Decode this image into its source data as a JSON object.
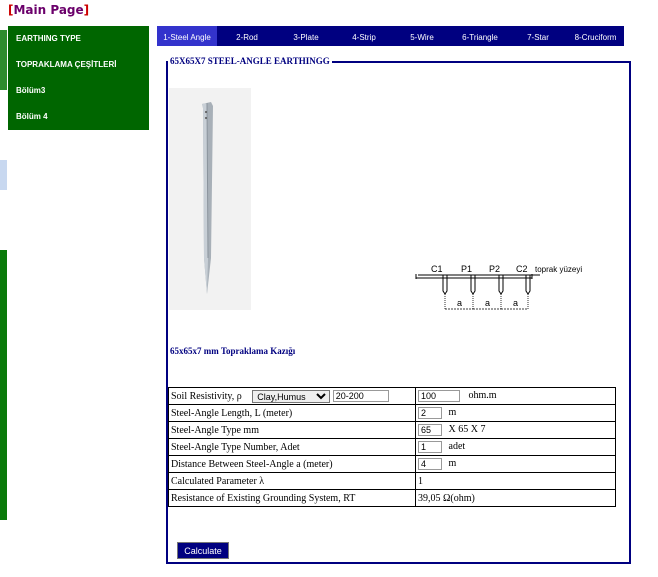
{
  "main_link": {
    "open": "[",
    "label": "Main Page",
    "close": "]"
  },
  "sidebar": {
    "items": [
      {
        "label": "EARTHING TYPE"
      },
      {
        "label": "TOPRAKLAMA ÇEŞİTLERİ"
      },
      {
        "label": "Bölüm3"
      },
      {
        "label": "Bölüm  4"
      }
    ]
  },
  "tabs": [
    {
      "label": "1-Steel Angle",
      "active": true
    },
    {
      "label": "2-Rod"
    },
    {
      "label": "3-Plate"
    },
    {
      "label": "4-Strip"
    },
    {
      "label": "5-Wire"
    },
    {
      "label": "6-Triangle"
    },
    {
      "label": "7-Star"
    },
    {
      "label": "8-Cruciform"
    }
  ],
  "panel": {
    "title": "65X65X7  STEEL-ANGLE EARTHINGG",
    "caption": "65x65x7 mm Topraklama Kazığı",
    "diagram": {
      "labels": [
        "C1",
        "P1",
        "P2",
        "C2"
      ],
      "surface_label": "toprak yüzeyi",
      "spacing_label": "a"
    }
  },
  "form": {
    "rows": [
      {
        "label": "Soil Resistivity, ρ",
        "select": "Clay,Humus",
        "range": "20-200",
        "value": "100",
        "unit": "ohm.m"
      },
      {
        "label": "Steel-Angle Length, L (meter)",
        "value": "2",
        "unit": "m"
      },
      {
        "label": "Steel-Angle Type  mm",
        "value": "65",
        "unit": "X 65  X  7"
      },
      {
        "label": "Steel-Angle Type Number, Adet",
        "value": "1",
        "unit": "adet"
      },
      {
        "label": "Distance Between Steel-Angle a (meter)",
        "value": "4",
        "unit": "m"
      },
      {
        "label": "Calculated Parameter  λ",
        "result": "1"
      },
      {
        "label": "Resistance of Existing Grounding System, RT",
        "result": "39,05 Ω(ohm)"
      }
    ]
  },
  "calculate_button": "Calculate",
  "colors": {
    "sidebar_green": "#006600",
    "tab_navy": "#000080",
    "tab_active": "#3333cc",
    "title_navy": "#000080"
  }
}
